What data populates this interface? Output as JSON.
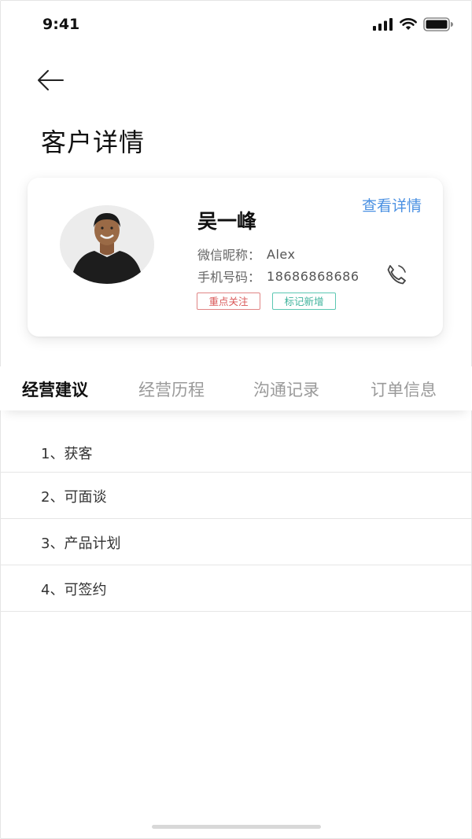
{
  "status_bar": {
    "time": "9:41"
  },
  "header": {
    "title": "客户详情"
  },
  "customer": {
    "name": "吴一峰",
    "view_details": "查看详情",
    "wechat_label": "微信昵称：",
    "wechat_value": "Alex",
    "phone_label": "手机号码：",
    "phone_value": "18686868686",
    "tags": [
      "重点关注",
      "标记新增"
    ],
    "colors": {
      "link": "#4a90e2",
      "tag_focus": "#d95757",
      "tag_new": "#3fb39c"
    }
  },
  "tabs": [
    {
      "label": "经营建议",
      "active": true
    },
    {
      "label": "经营历程",
      "active": false
    },
    {
      "label": "沟通记录",
      "active": false
    },
    {
      "label": "订单信息",
      "active": false
    }
  ],
  "suggestions": [
    "1、获客",
    "2、可面谈",
    "3、产品计划",
    "4、可签约"
  ],
  "icons": {
    "back": "arrow-left-icon",
    "phone": "phone-icon",
    "signal": "signal-icon",
    "wifi": "wifi-icon",
    "battery": "battery-icon"
  }
}
